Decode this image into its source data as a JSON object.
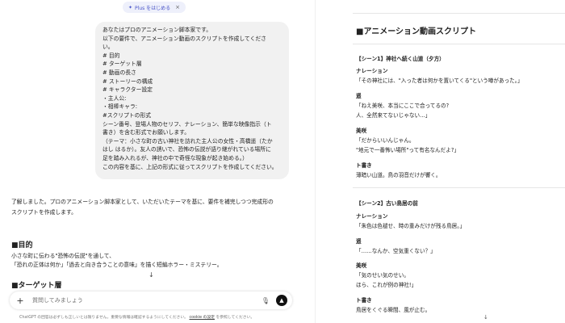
{
  "plus_pill": {
    "label": "Plus をはじめる",
    "close": "×"
  },
  "prompt_lines": [
    "あなたはプロのアニメーション脚本家です。",
    "以下の要件で、アニメーション動画のスクリプトを作成してくださ",
    "い。",
    "# 目的",
    "# ターゲット層",
    "# 動画の長さ",
    "# ストーリーの構成",
    "# キャラクター設定",
    "・主人公:",
    "・相棒キャラ:",
    "#スクリプトの形式",
    "シーン番号、登場人物のセリフ、ナレーション、簡単な映像指示（ト",
    "書き）を含む形式でお願いします。",
    "（テーマ：小さな町の古い神社を訪れた主人公の女性・高橋遥（たか",
    "はし はるか）。友人の誘いで、恐怖の伝説が語り継がれている場所に",
    "足を踏み入れるが、神社の中で奇怪な現象が起き始める。）",
    "この内容を基に、上記の形式に従ってスクリプトを作成してください。"
  ],
  "answer": {
    "line1": "了解しました。プロのアニメーション脚本家として、いただいたテーマを基に、要件を補完しつつ完成形の",
    "line2": "スクリプトを作成します。"
  },
  "goal_heading": "■目的",
  "goal_lines": [
    "小さな町に伝わる\"恐怖の伝説\"を通して、",
    "「恐れの正体は何か」「過去と向き合うことの意味」を描く短編ホラー・ミステリー。"
  ],
  "target_heading": "■ターゲット層",
  "input": {
    "placeholder": "質問してみましょう",
    "plus": "+",
    "mic": "🎙",
    "send": "▲"
  },
  "disclaimer": {
    "text": "ChatGPT の回答は必ずしも正しいとは限りません。重要な情報は確認するようにしてください。",
    "link": "cookie の設定",
    "tail": "を参照してください。"
  },
  "script_panel": {
    "title": "■アニメーション動画スクリプト",
    "scene1": {
      "heading": "【シーン1】神社へ続く山道（夕方）",
      "narration_label": "ナレーション",
      "narration": "「その神社には、\"入った者は何かを置いてくる\"という噂があった。」",
      "haruka_label": "遥",
      "haruka_1": "「ねえ美咲、本当にここで合ってるの?",
      "haruka_2": "人、全然来てないじゃない…」",
      "misaki_label": "美咲",
      "misaki_1": "「だからいいんじゃん。",
      "misaki_2": "\"地元で一番怖い場所\"って有名なんだよ?」",
      "togaki_label": "ト書き",
      "togaki": "薄暗い山道。鳥の羽音だけが響く。"
    },
    "scene2": {
      "heading": "【シーン2】古い鳥居の前",
      "narration_label": "ナレーション",
      "narration": "「朱色は色褪せ、時の重みだけが残る鳥居。」",
      "haruka_label": "遥",
      "haruka": "「……なんか、空気重くない？」",
      "misaki_label": "美咲",
      "misaki_1": "「気のせい気のせい。",
      "misaki_2": "ほら、これが例の神社!」",
      "togaki_label": "ト書き",
      "togaki": "鳥居をくぐる瞬間、風が止む。"
    }
  },
  "scroll_arrow": "↓"
}
